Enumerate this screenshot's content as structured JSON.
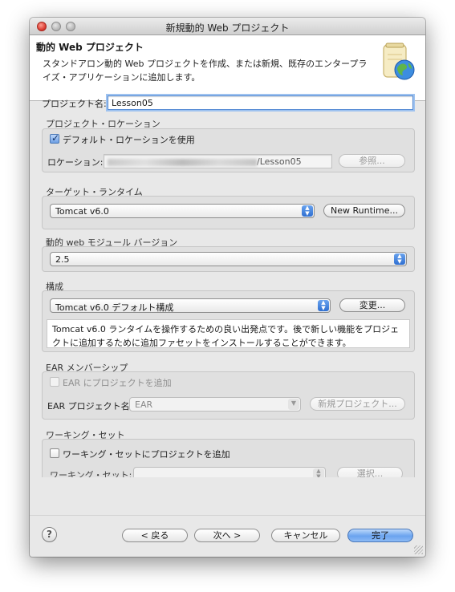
{
  "window": {
    "title": "新規動的 Web プロジェクト"
  },
  "header": {
    "title": "動的 Web プロジェクト",
    "description": "スタンドアロン動的 Web プロジェクトを作成、または新規、既存のエンタープライズ・アプリケーションに追加します。"
  },
  "project": {
    "name_label": "プロジェクト名:",
    "name_value": "Lesson05"
  },
  "location": {
    "group_title": "プロジェクト・ロケーション",
    "use_default_label": "デフォルト・ロケーションを使用",
    "use_default_checked": true,
    "location_label": "ロケーション:",
    "location_value_suffix": "/Lesson05",
    "browse_button": "参照..."
  },
  "runtime": {
    "group_title": "ターゲット・ランタイム",
    "selected": "Tomcat v6.0",
    "new_button": "New Runtime..."
  },
  "module": {
    "group_title": "動的 web モジュール バージョン",
    "selected": "2.5"
  },
  "configuration": {
    "group_title": "構成",
    "selected": "Tomcat v6.0 デフォルト構成",
    "modify_button": "変更...",
    "description": "Tomcat v6.0 ランタイムを操作するための良い出発点です。後で新しい機能をプロジェクトに追加するために追加ファセットをインストールすることができます。"
  },
  "ear": {
    "group_title": "EAR メンバーシップ",
    "add_label": "EAR にプロジェクトを追加",
    "project_label": "EAR プロジェクト名:",
    "project_value": "EAR",
    "new_project_button": "新規プロジェクト..."
  },
  "working_sets": {
    "group_title": "ワーキング・セット",
    "add_label": "ワーキング・セットにプロジェクトを追加",
    "sets_label": "ワーキング・セット:",
    "select_button": "選択..."
  },
  "footer": {
    "help": "?",
    "back_button": "< 戻る",
    "next_button": "次へ >",
    "cancel_button": "キャンセル",
    "finish_button": "完了"
  }
}
